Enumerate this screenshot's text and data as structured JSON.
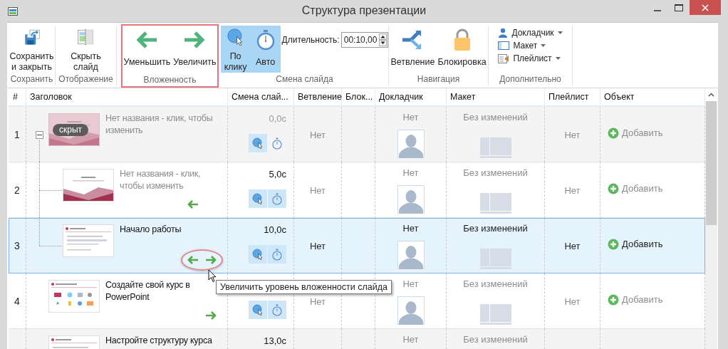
{
  "window": {
    "title": "Структура презентации"
  },
  "ribbon": {
    "save": {
      "label": "Сохранить",
      "button": "Сохранить\nи закрыть"
    },
    "display": {
      "label": "Отображение",
      "button": "Скрыть\nслайд"
    },
    "nesting": {
      "label": "Вложенность",
      "highlighted": true,
      "decrease": "Уменьшить",
      "increase": "Увеличить"
    },
    "transition": {
      "label": "Смена слайда",
      "on_click": {
        "label": "По\nклику",
        "selected": true
      },
      "auto": {
        "label": "Авто",
        "selected": true
      },
      "duration_label": "Длительность:",
      "duration": "00:10,00"
    },
    "navigation": {
      "label": "Навигация",
      "branch": "Ветвление",
      "lock": "Блокировка"
    },
    "extra": {
      "label": "Дополнительно",
      "speaker": "Докладчик",
      "layout": "Макет",
      "playlist": "Плейлист"
    }
  },
  "table": {
    "columns": [
      "#",
      "Заголовок",
      "Смена слай...",
      "Ветвление",
      "Блок...",
      "Докладчик",
      "Макет",
      "Плейлист",
      "Объект"
    ],
    "rows": [
      {
        "number": "1",
        "title": "Нет названия - клик, чтобы изменить",
        "untitled": true,
        "thumbnail": {
          "kind": "title"
        },
        "hidden": true,
        "badge": "скрыт",
        "expanded": true,
        "selected": false,
        "can_decrease": false,
        "can_increase": false,
        "duration": "0,0с",
        "on_click": true,
        "auto": false,
        "branch": "Нет",
        "speaker": "Нет",
        "layout": "Без изменений",
        "playlist": "Нет",
        "object": "Добавить",
        "children": [
          {
            "number": "2",
            "title": "Нет названия - клик, чтобы изменить",
            "untitled": true,
            "thumbnail": {
              "kind": "title"
            },
            "hidden": false,
            "selected": false,
            "can_decrease": true,
            "can_increase": false,
            "duration": "5,0с",
            "on_click": true,
            "auto": true,
            "branch": "Нет",
            "speaker": "Нет",
            "layout": "Без изменений",
            "playlist": "Нет",
            "object": "Добавить"
          },
          {
            "number": "3",
            "title": "Начало работы",
            "untitled": false,
            "thumbnail": {
              "kind": "text"
            },
            "hidden": false,
            "selected": true,
            "highlighted": true,
            "can_decrease": true,
            "can_increase": true,
            "duration": "10,0с",
            "on_click": true,
            "auto": true,
            "branch": "Нет",
            "speaker": "Нет",
            "layout": "Без изменений",
            "playlist": "Нет",
            "object": "Добавить"
          }
        ]
      },
      {
        "number": "4",
        "title": "Создайте свой курс в PowerPoint",
        "untitled": false,
        "thumbnail": {
          "kind": "grid"
        },
        "hidden": false,
        "selected": false,
        "can_decrease": false,
        "can_increase": true,
        "on_click": true,
        "auto": true,
        "branch": "Нет",
        "speaker": "Нет",
        "layout": "Без изменений",
        "playlist": "Нет",
        "object": "Добавить"
      },
      {
        "title": "Настройте структуру курса",
        "untitled": false,
        "thumbnail": {
          "kind": "text"
        },
        "hidden": false,
        "selected": false,
        "duration": "13,0с",
        "speaker": "Нет",
        "layout": "Без изменений"
      }
    ]
  },
  "tooltip": {
    "text": "Увеличить уровень вложенности слайда"
  }
}
